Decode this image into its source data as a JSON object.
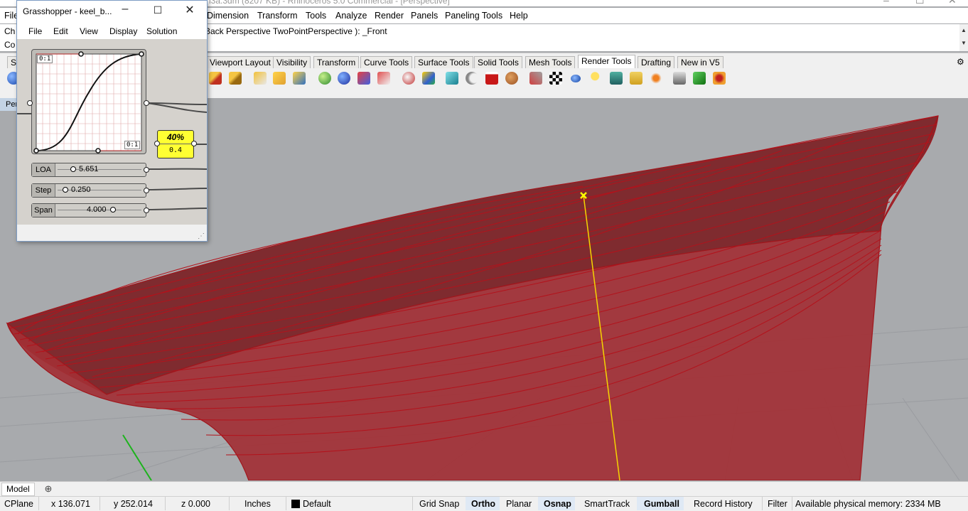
{
  "app": {
    "title": "n3a.3dm (8207 KB) - Rhinoceros 5.0 Commercial - [Perspective]"
  },
  "menu": [
    "File",
    "Dimension",
    "Transform",
    "Tools",
    "Analyze",
    "Render",
    "Panels",
    "Paneling Tools",
    "Help"
  ],
  "command": {
    "prompt_prefix": "Ch",
    "history": "Back  Perspective  TwoPointPerspective ): _Front",
    "command_prefix": "Co"
  },
  "tabs": [
    "St",
    "Viewport Layout",
    "Visibility",
    "Transform",
    "Curve Tools",
    "Surface Tools",
    "Solid Tools",
    "Mesh Tools",
    "Render Tools",
    "Drafting",
    "New in V5"
  ],
  "active_tab": "Render Tools",
  "viewport": {
    "label": "Per"
  },
  "grasshopper": {
    "title": "Grasshopper - keel_b...",
    "menu": [
      "File",
      "Edit",
      "View",
      "Display",
      "Solution"
    ],
    "graph_range_top": "0:1",
    "graph_range_bottom": "0:1",
    "panel_percent": "40%",
    "panel_value": "0.4",
    "sliders": [
      {
        "label": "LOA",
        "value": "5.651",
        "position": 0.05
      },
      {
        "label": "Step",
        "value": "0.250",
        "position": 0.0
      },
      {
        "label": "Span",
        "value": "4.000",
        "position": 0.7
      }
    ]
  },
  "model_tabs": [
    "Model"
  ],
  "status": {
    "cplane": "CPlane",
    "x": "x 136.071",
    "y": "y 252.014",
    "z": "z 0.000",
    "units": "Inches",
    "layer": "Default",
    "grid_snap": "Grid Snap",
    "ortho": "Ortho",
    "planar": "Planar",
    "osnap": "Osnap",
    "smarttrack": "SmartTrack",
    "gumball": "Gumball",
    "record_history": "Record History",
    "filter": "Filter",
    "memory": "Available physical memory: 2334 MB"
  },
  "colors": {
    "surface": "#a51e24",
    "viewport_bg": "#a8aaad",
    "selection": "#ffff00",
    "gh_panel": "#ffff33"
  },
  "icons": [
    "render-sphere-icon",
    "light-icon",
    "materials-icon",
    "environment-icon",
    "texture-icon",
    "render-window-icon",
    "render-icon"
  ]
}
